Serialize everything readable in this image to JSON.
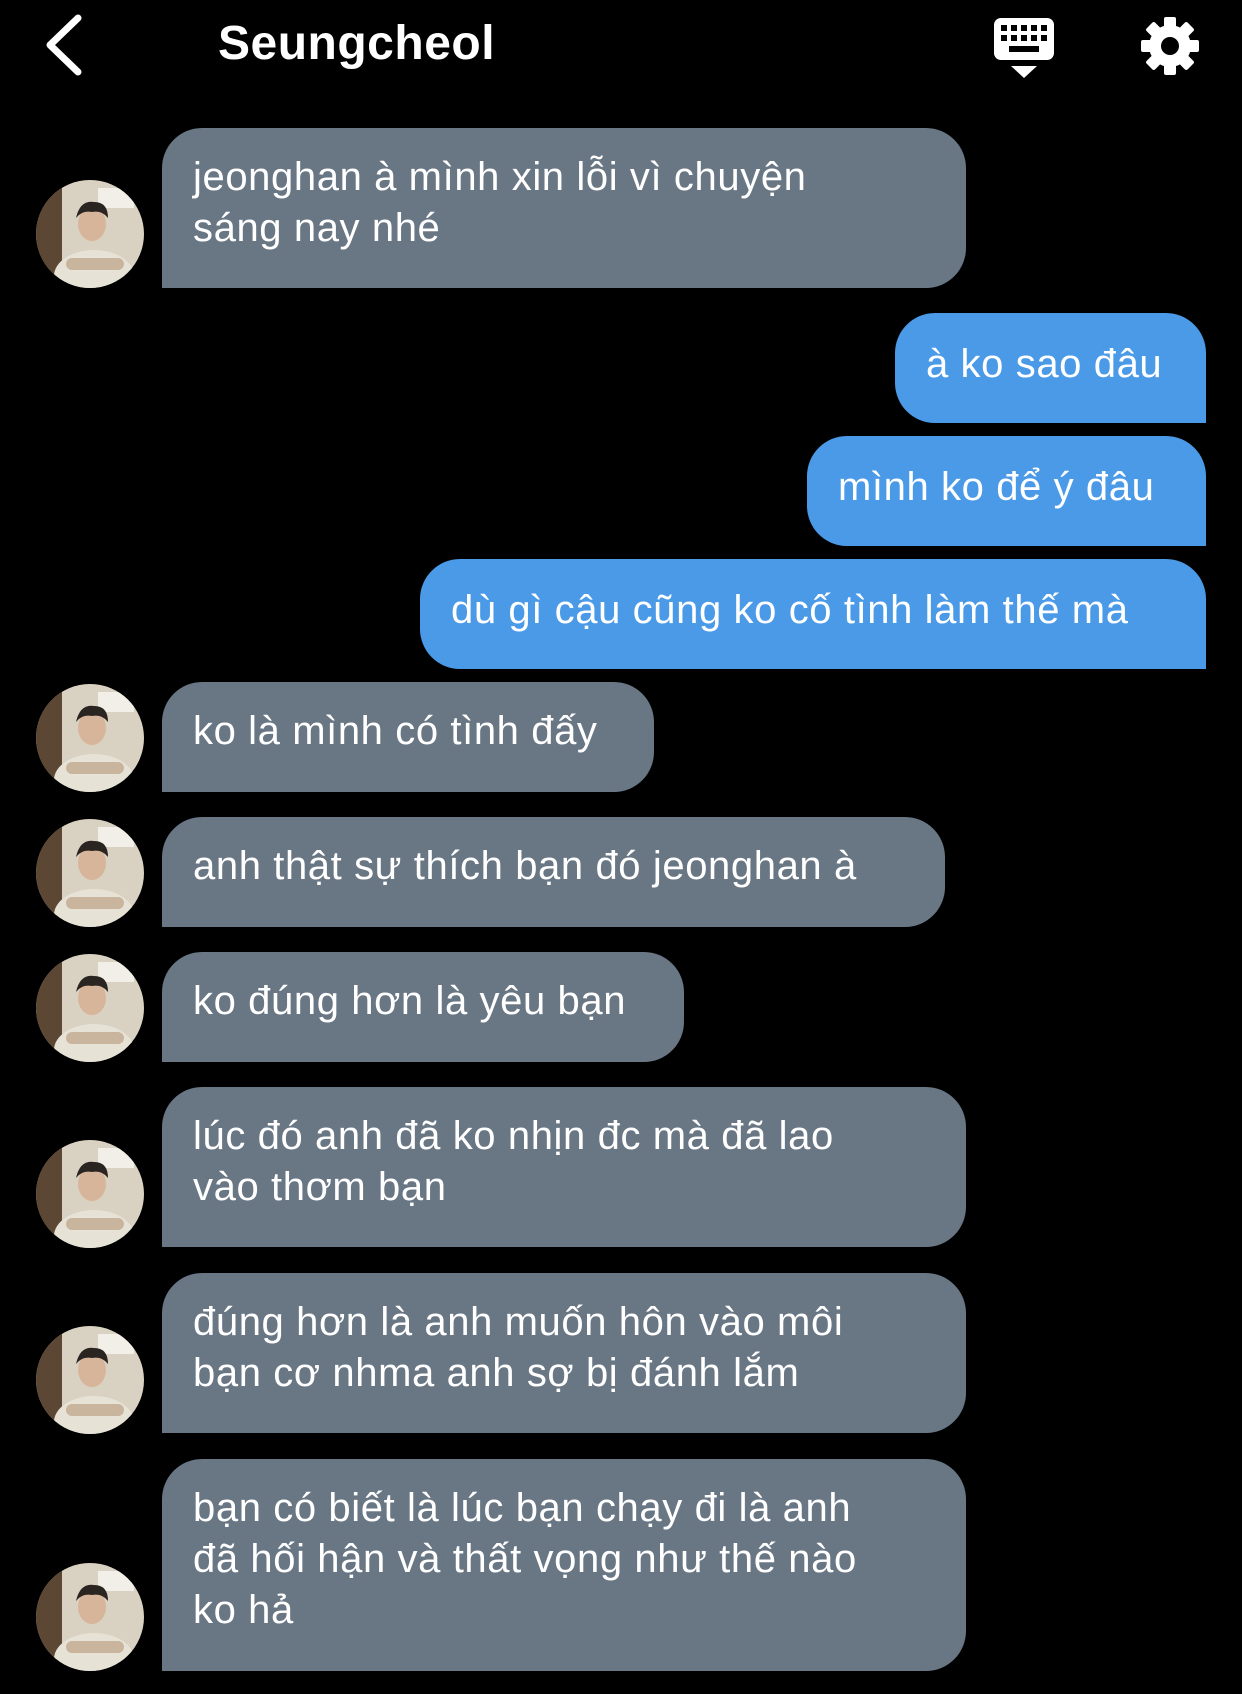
{
  "header": {
    "title": "Seungcheol",
    "back_icon": "chevron-left-icon",
    "keyboard_icon": "keyboard-hide-icon",
    "settings_icon": "gear-icon"
  },
  "colors": {
    "background": "#000000",
    "incoming_bubble": "#697684",
    "outgoing_bubble": "#4a9ae8",
    "text": "#ffffff"
  },
  "messages": [
    {
      "direction": "in",
      "text": "jeonghan à mình xin lỗi vì chuyện\nsáng nay nhé"
    },
    {
      "direction": "out",
      "text": "à ko sao đâu"
    },
    {
      "direction": "out",
      "text": "mình ko để ý đâu"
    },
    {
      "direction": "out",
      "text": "dù gì cậu cũng ko cố tình làm thế mà"
    },
    {
      "direction": "in",
      "text": "ko là mình có tình đấy"
    },
    {
      "direction": "in",
      "text": "anh thật sự thích bạn đó jeonghan à"
    },
    {
      "direction": "in",
      "text": "ko đúng hơn là yêu bạn"
    },
    {
      "direction": "in",
      "text": "lúc đó anh đã ko nhịn đc mà đã lao\nvào thơm bạn"
    },
    {
      "direction": "in",
      "text": "đúng hơn là anh muốn hôn vào môi\nbạn cơ nhma anh sợ bị đánh lắm"
    },
    {
      "direction": "in",
      "text": "bạn có biết là lúc bạn chạy đi là anh\nđã hối hận và thất vọng như thế nào\nko hả"
    }
  ]
}
